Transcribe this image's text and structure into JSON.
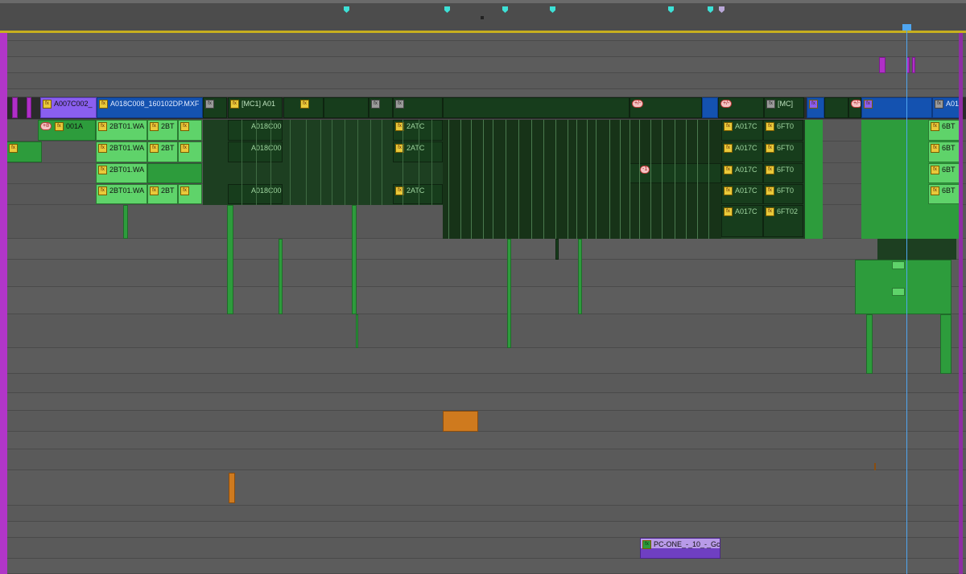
{
  "timeline": {
    "ruler": {
      "markers": [
        "marker",
        "marker",
        "marker",
        "marker",
        "marker",
        "marker",
        "marker"
      ]
    },
    "upper_track": {
      "clips": [
        {
          "label": "A007C002_",
          "color": "violet",
          "fx": "fx"
        },
        {
          "label": "A018C008_160102DP.MXF",
          "color": "blue",
          "fx": "fx"
        },
        {
          "label": "[MC1] A01",
          "color": "dgreen",
          "fx": "fx"
        },
        {
          "label": "[MC]",
          "color": "dgreen",
          "fx": "fx"
        },
        {
          "label": "[MC]",
          "color": "dgreen",
          "fx": "fx"
        },
        {
          "label": "A01",
          "color": "blue",
          "fx": "fx"
        }
      ],
      "badges": [
        "+/-",
        "+/-",
        "+/-"
      ]
    },
    "audio_track_1": {
      "clips": [
        {
          "label": "001A",
          "badge": "+8",
          "fx": "fx"
        },
        {
          "label": "2BT01.WA",
          "fx": "fx"
        },
        {
          "label": "2BT",
          "fx": "fx"
        },
        {
          "label": "A018C00",
          "fx": "fx"
        },
        {
          "label": "2ATC",
          "fx": "fx"
        },
        {
          "label": "A017C",
          "fx": "fx"
        },
        {
          "label": "6FT0",
          "fx": "fx"
        },
        {
          "label": "6BT",
          "fx": "fx"
        }
      ]
    },
    "audio_track_2": {
      "clips": [
        {
          "label": "2BT01.WA",
          "fx": "fx"
        },
        {
          "label": "2BT",
          "fx": "fx"
        },
        {
          "label": "A018C00",
          "fx": "fx"
        },
        {
          "label": "2ATC",
          "fx": "fx"
        },
        {
          "label": "A017C",
          "fx": "fx"
        },
        {
          "label": "6FT0",
          "fx": "fx"
        },
        {
          "label": "6BT",
          "fx": "fx"
        }
      ]
    },
    "audio_track_3": {
      "clips": [
        {
          "label": "2BT01.WA",
          "fx": "fx"
        },
        {
          "label": "A017C",
          "fx": "fx"
        },
        {
          "label": "6FT0",
          "fx": "fx"
        },
        {
          "label": "6BT",
          "fx": "fx"
        }
      ],
      "badges": [
        "-1"
      ]
    },
    "audio_track_4": {
      "clips": [
        {
          "label": "2BT01.WA",
          "fx": "fx"
        },
        {
          "label": "2BT",
          "fx": "fx"
        },
        {
          "label": "A018C00",
          "fx": "fx"
        },
        {
          "label": "2ATC",
          "fx": "fx"
        },
        {
          "label": "A017C",
          "fx": "fx"
        },
        {
          "label": "6FT0",
          "fx": "fx"
        },
        {
          "label": "6BT",
          "fx": "fx"
        }
      ]
    },
    "audio_track_5": {
      "clips": [
        {
          "label": "A017C",
          "fx": "fx"
        },
        {
          "label": "6FT02",
          "fx": "fx"
        }
      ]
    },
    "bottom_clip": {
      "label": "PC-ONE_-_10_-_Gc",
      "fx": "fx"
    },
    "colors": {
      "background": "#5a5a5a",
      "green": "#2d9c3c",
      "light_green": "#5fd36a",
      "dark_green": "#173d1c",
      "blue": "#1452b0",
      "violet": "#8a5ff0",
      "magenta": "#b02fc7",
      "orange": "#cf7a1e",
      "purple": "#7a46c9",
      "playhead": "#4fa6f0",
      "marker": "#3de0d6"
    }
  }
}
